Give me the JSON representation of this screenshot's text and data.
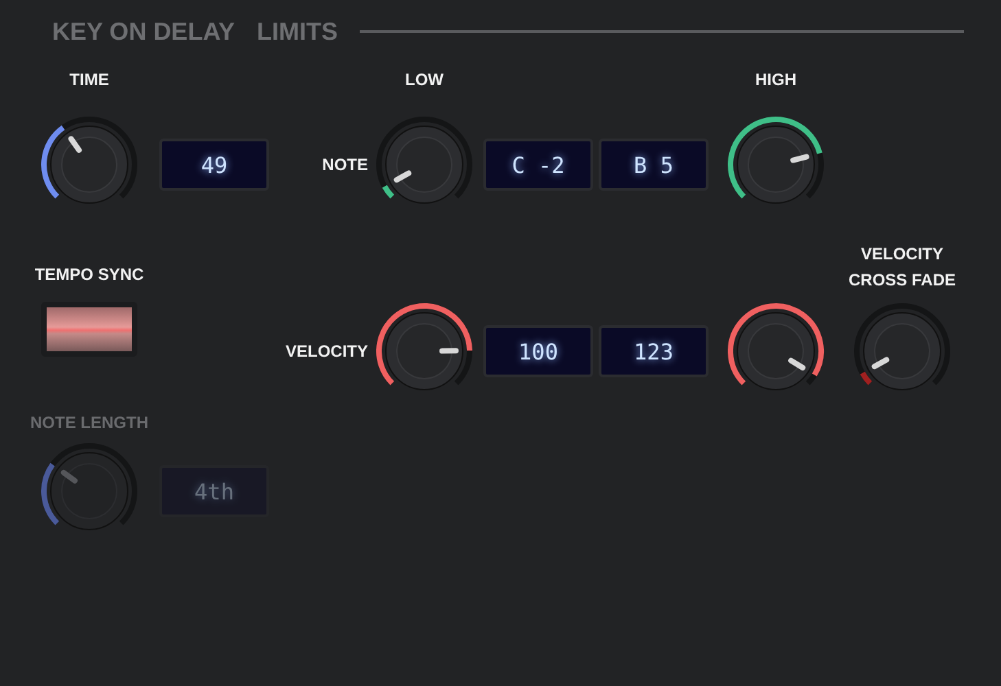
{
  "titles": [
    "KEY ON DELAY",
    "LIMITS"
  ],
  "time": {
    "label": "TIME",
    "knob": {
      "color": "#6f8df0"
    },
    "value": "49"
  },
  "tempo_sync": {
    "label": "TEMPO SYNC",
    "on": true
  },
  "note_length": {
    "label": "NOTE LENGTH",
    "disabled": true,
    "knob": {
      "color": "#4a5a9a"
    },
    "value": "4th"
  },
  "limits": {
    "low_label": "LOW",
    "high_label": "HIGH",
    "crossfade_label": "VELOCITY CROSS FADE",
    "rows": [
      {
        "label": "NOTE",
        "low_knob": {
          "color": "#3fbf88"
        },
        "low_value": "C -2",
        "high_value": "B 5",
        "high_knob": {
          "color": "#3fbf88"
        }
      },
      {
        "label": "VELOCITY",
        "low_knob": {
          "color": "#f06060"
        },
        "low_value": "100",
        "high_value": "123",
        "high_knob": {
          "color": "#f06060"
        },
        "crossfade_knob": {
          "color": "#a02020"
        }
      }
    ]
  }
}
